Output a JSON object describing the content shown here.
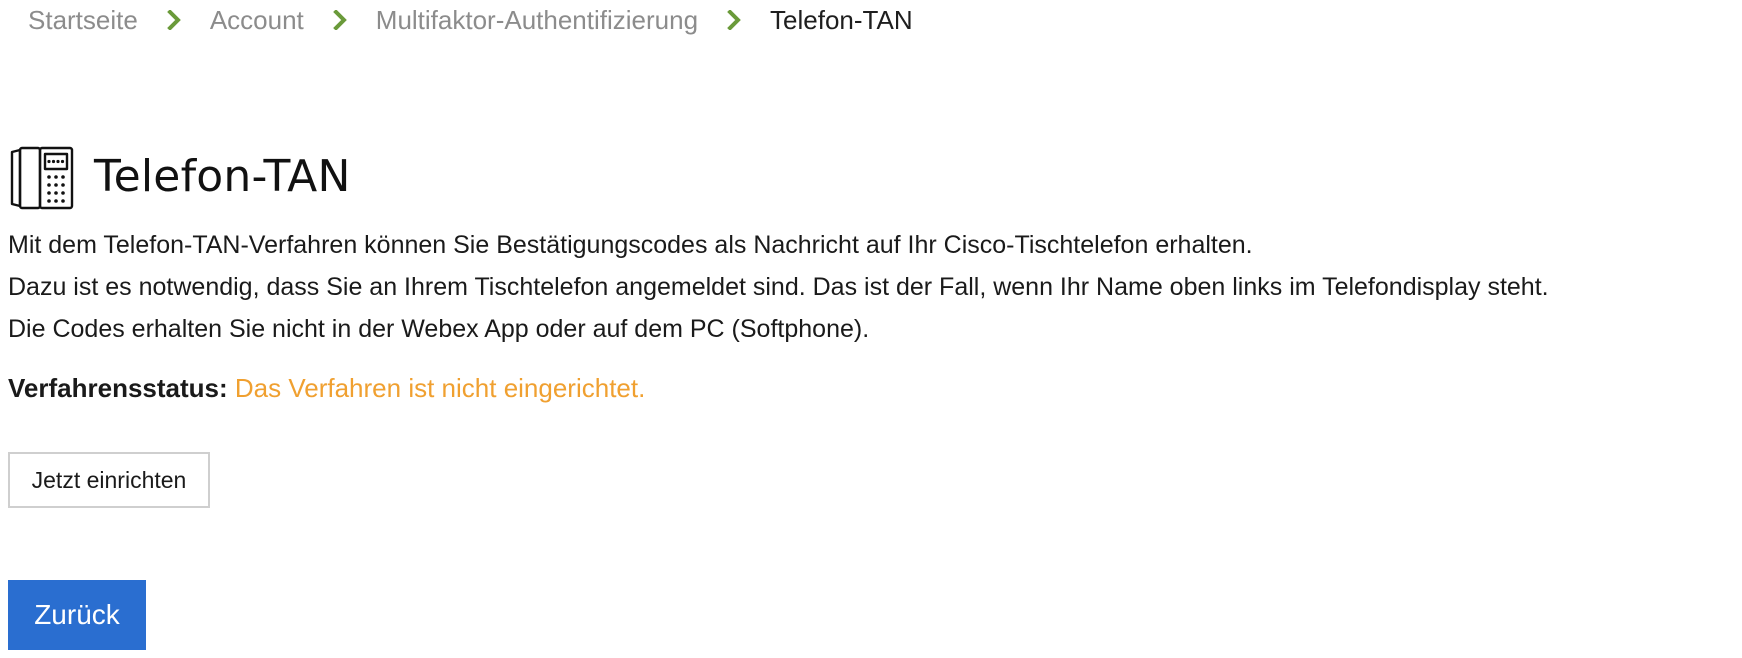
{
  "breadcrumb": {
    "items": [
      {
        "label": "Startseite"
      },
      {
        "label": "Account"
      },
      {
        "label": "Multifaktor-Authentifizierung"
      }
    ],
    "current": "Telefon-TAN",
    "separator_icon": "chevron-right-icon",
    "separator_color": "#6a9a3a"
  },
  "page": {
    "icon": "desk-phone-icon",
    "title": "Telefon-TAN",
    "description": [
      "Mit dem Telefon-TAN-Verfahren können Sie Bestätigungscodes als Nachricht auf Ihr Cisco-Tischtelefon erhalten.",
      "Dazu ist es notwendig, dass Sie an Ihrem Tischtelefon angemeldet sind. Das ist der Fall, wenn Ihr Name oben links im Telefondisplay steht.",
      "Die Codes erhalten Sie nicht in der Webex App oder auf dem PC (Softphone)."
    ],
    "status_label": "Verfahrensstatus:",
    "status_value": "Das Verfahren ist nicht eingerichtet.",
    "status_color": "#f0a030"
  },
  "actions": {
    "setup_label": "Jetzt einrichten",
    "back_label": "Zurück",
    "back_color": "#2a6ed0"
  }
}
